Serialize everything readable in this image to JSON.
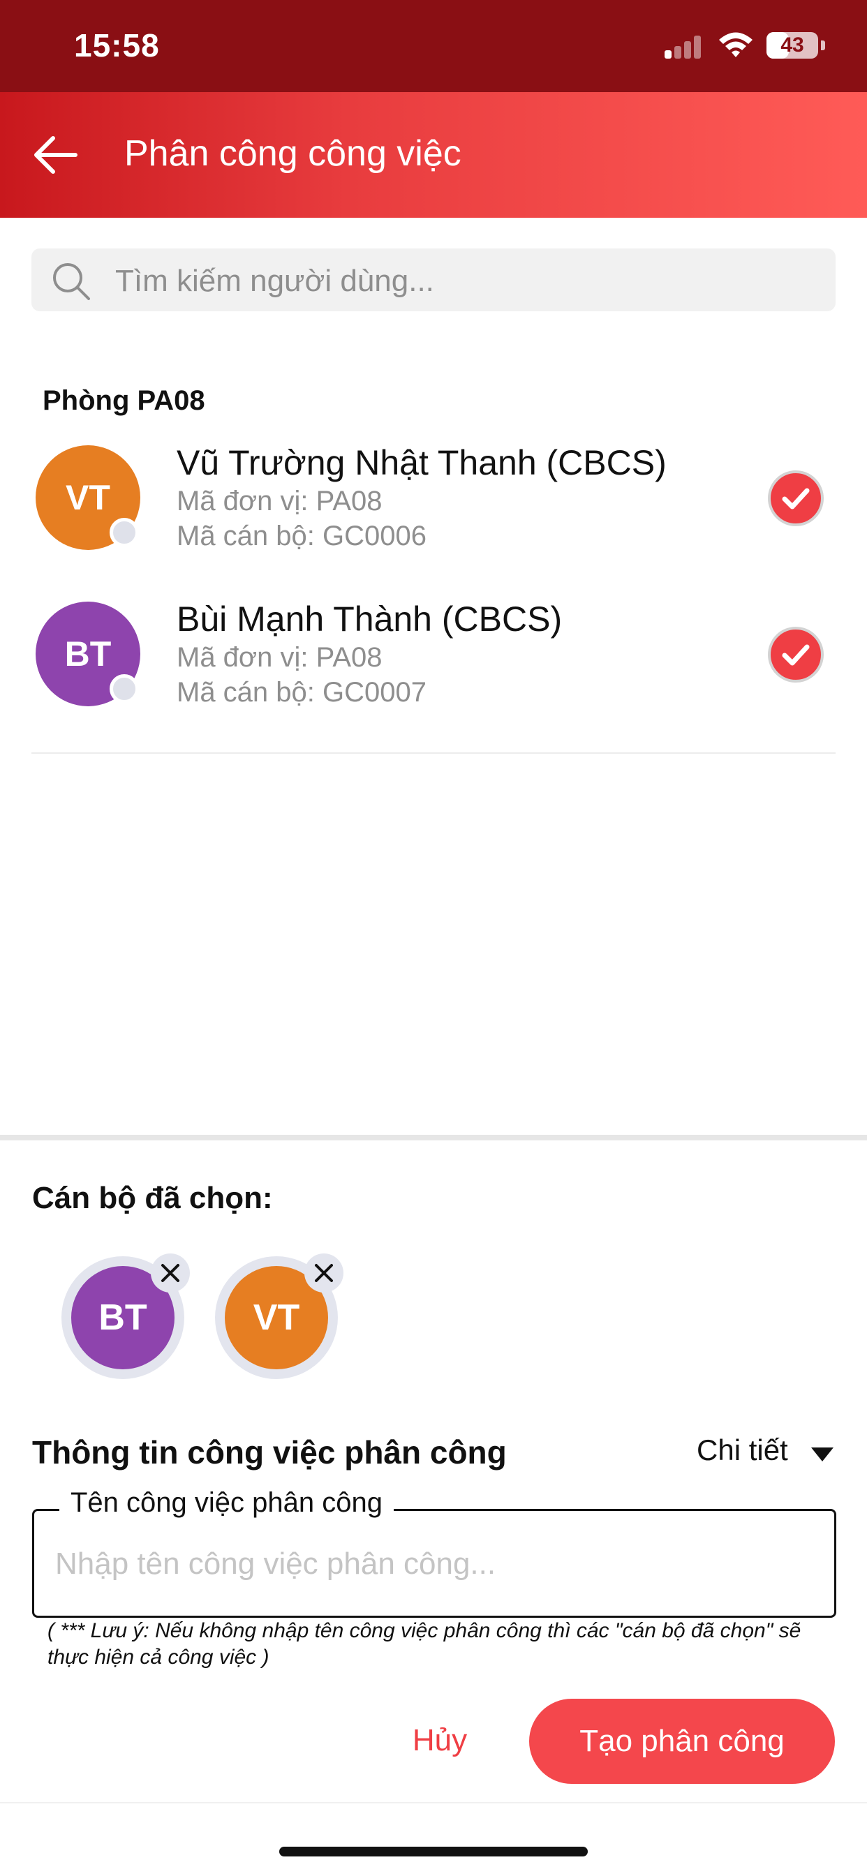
{
  "status_bar": {
    "time": "15:58",
    "battery": "43",
    "battery_level": 0.43
  },
  "header": {
    "title": "Phân công công việc"
  },
  "search": {
    "placeholder": "Tìm kiếm người dùng..."
  },
  "group": {
    "title": "Phòng PA08",
    "users": [
      {
        "initials": "VT",
        "name": "Vũ Trường Nhật Thanh (CBCS)",
        "unit": "Mã đơn vị: PA08",
        "code": "Mã cán bộ: GC0006",
        "color": "#e67e22",
        "checked": true
      },
      {
        "initials": "BT",
        "name": "Bùi Mạnh Thành (CBCS)",
        "unit": "Mã đơn vị: PA08",
        "code": "Mã cán bộ: GC0007",
        "color": "#8e44ad",
        "checked": true
      }
    ]
  },
  "selected": {
    "title": "Cán bộ đã chọn:",
    "chips": [
      {
        "initials": "BT",
        "color": "#8e44ad"
      },
      {
        "initials": "VT",
        "color": "#e67e22"
      }
    ]
  },
  "task_info": {
    "title": "Thông tin công việc phân công",
    "detail_label": "Chi tiết",
    "field_label": "Tên công việc phân công",
    "field_placeholder": "Nhập tên công việc phân công...",
    "field_value": "",
    "note": "( *** Lưu ý: Nếu không nhập tên công việc phân công thì các \"cán bộ đã chọn\" sẽ thực hiện cả công việc )"
  },
  "actions": {
    "cancel_label": "Hủy",
    "create_label": "Tạo phân công"
  },
  "colors": {
    "status_bar": "#8a0f14",
    "header_start": "#c8181d",
    "header_end": "#ff5b57",
    "accent": "#ef3e44"
  }
}
